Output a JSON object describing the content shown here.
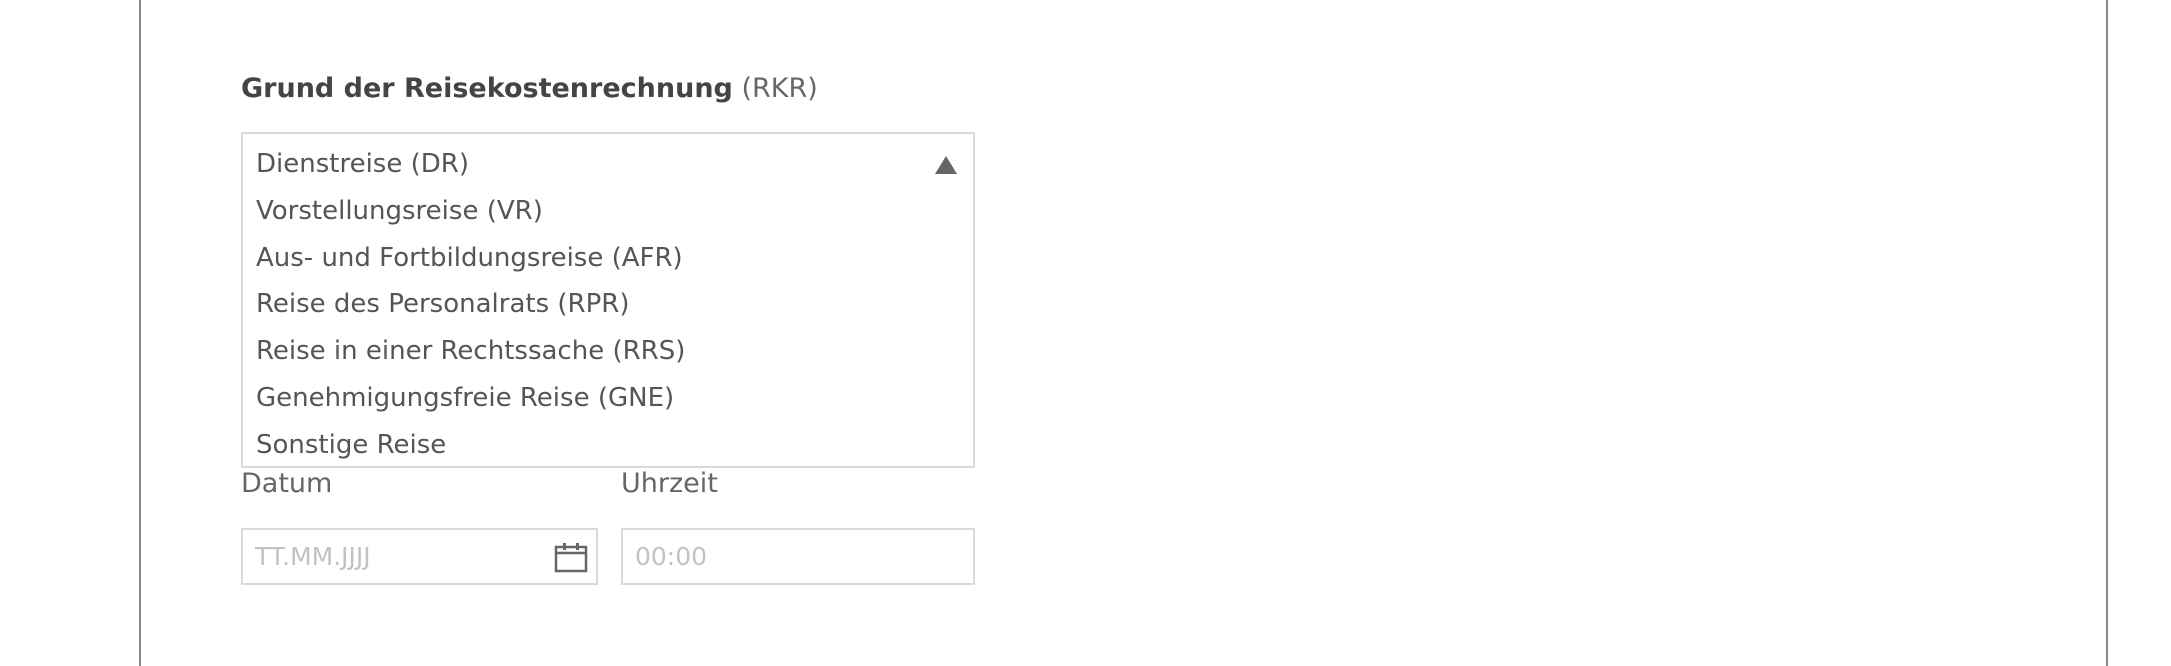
{
  "form": {
    "reason_label_bold": "Grund der Reisekostenrechnung",
    "reason_label_suffix": " (RKR)",
    "reason_options": [
      "Dienstreise (DR)",
      "Vorstellungsreise (VR)",
      "Aus- und Fortbildungsreise (AFR)",
      "Reise des Personalrats (RPR)",
      "Reise in einer Rechtssache (RRS)",
      "Genehmigungsfreie Reise (GNE)",
      "Sonstige Reise"
    ],
    "date_label": "Datum",
    "date_placeholder": "TT.MM.JJJJ",
    "time_label": "Uhrzeit",
    "time_placeholder": "00:00"
  },
  "icons": {
    "listbox_toggle": "triangle-up-icon",
    "date_picker": "calendar-icon"
  },
  "colors": {
    "text": "#555555",
    "border": "#d9d9d9",
    "placeholder": "#c2c2c2",
    "frame": "#8a8a8a"
  }
}
